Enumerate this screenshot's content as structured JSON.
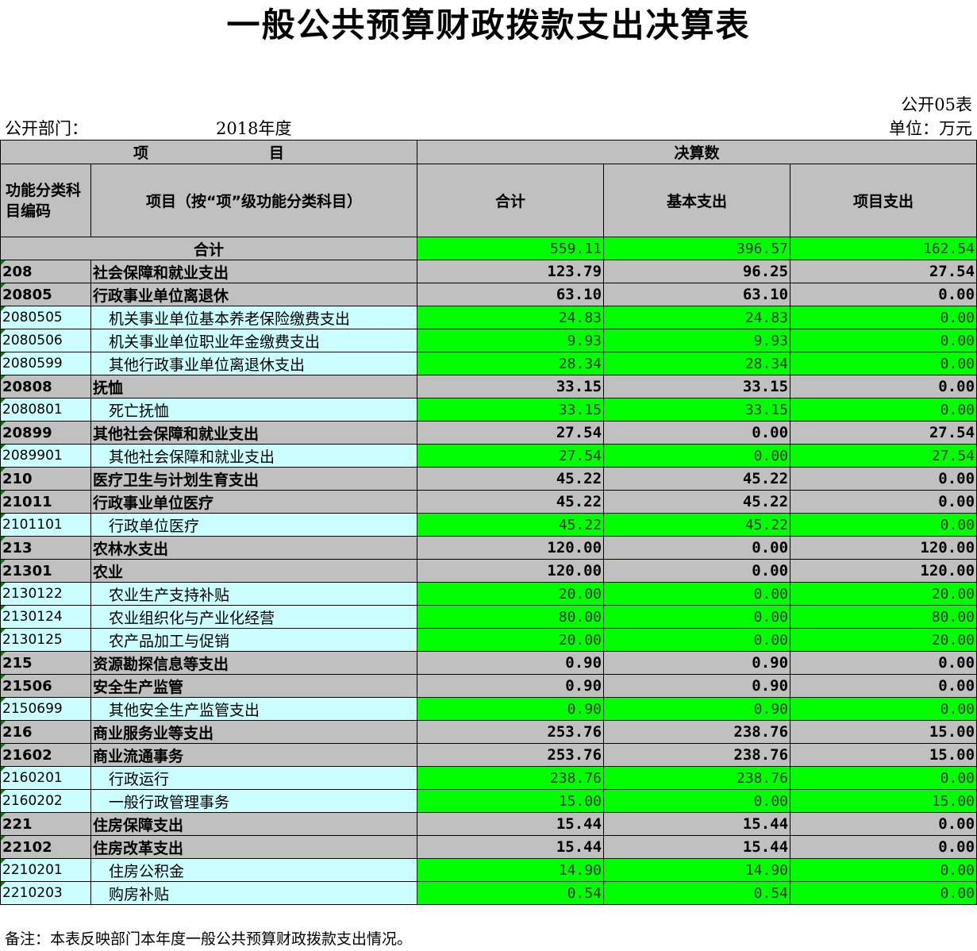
{
  "title": "一般公共预算财政拨款支出决算表",
  "form_code": "公开05表",
  "department_label": "公开部门：",
  "year": "2018年度",
  "unit": "单位：万元",
  "header": {
    "project": "项　　　　　　　　目",
    "final_accounts": "决算数",
    "code_col": "功能分类科目编码",
    "name_col": "项目（按“项”级功能分类科目）",
    "total_col": "合计",
    "basic_col": "基本支出",
    "project_col": "项目支出"
  },
  "total_row": {
    "label": "合计",
    "total": "559.11",
    "basic": "396.57",
    "project": "162.54"
  },
  "rows": [
    {
      "level": "group",
      "code": "208",
      "name": "社会保障和就业支出",
      "total": "123.79",
      "basic": "96.25",
      "project": "27.54"
    },
    {
      "level": "group",
      "code": "20805",
      "name": "行政事业单位离退休",
      "total": "63.10",
      "basic": "63.10",
      "project": "0.00"
    },
    {
      "level": "item",
      "code": "2080505",
      "name": "机关事业单位基本养老保险缴费支出",
      "total": "24.83",
      "basic": "24.83",
      "project": "0.00"
    },
    {
      "level": "item",
      "code": "2080506",
      "name": "机关事业单位职业年金缴费支出",
      "total": "9.93",
      "basic": "9.93",
      "project": "0.00"
    },
    {
      "level": "item",
      "code": "2080599",
      "name": "其他行政事业单位离退休支出",
      "total": "28.34",
      "basic": "28.34",
      "project": "0.00"
    },
    {
      "level": "group",
      "code": "20808",
      "name": "抚恤",
      "total": "33.15",
      "basic": "33.15",
      "project": "0.00"
    },
    {
      "level": "item",
      "code": "2080801",
      "name": "死亡抚恤",
      "total": "33.15",
      "basic": "33.15",
      "project": "0.00"
    },
    {
      "level": "group",
      "code": "20899",
      "name": "其他社会保障和就业支出",
      "total": "27.54",
      "basic": "0.00",
      "project": "27.54"
    },
    {
      "level": "item",
      "code": "2089901",
      "name": "其他社会保障和就业支出",
      "total": "27.54",
      "basic": "0.00",
      "project": "27.54"
    },
    {
      "level": "group",
      "code": "210",
      "name": "医疗卫生与计划生育支出",
      "total": "45.22",
      "basic": "45.22",
      "project": "0.00"
    },
    {
      "level": "group",
      "code": "21011",
      "name": "行政事业单位医疗",
      "total": "45.22",
      "basic": "45.22",
      "project": "0.00"
    },
    {
      "level": "item",
      "code": "2101101",
      "name": "行政单位医疗",
      "total": "45.22",
      "basic": "45.22",
      "project": "0.00"
    },
    {
      "level": "group",
      "code": "213",
      "name": "农林水支出",
      "total": "120.00",
      "basic": "0.00",
      "project": "120.00"
    },
    {
      "level": "group",
      "code": "21301",
      "name": "农业",
      "total": "120.00",
      "basic": "0.00",
      "project": "120.00"
    },
    {
      "level": "item",
      "code": "2130122",
      "name": "农业生产支持补贴",
      "total": "20.00",
      "basic": "0.00",
      "project": "20.00"
    },
    {
      "level": "item",
      "code": "2130124",
      "name": "农业组织化与产业化经营",
      "total": "80.00",
      "basic": "0.00",
      "project": "80.00"
    },
    {
      "level": "item",
      "code": "2130125",
      "name": "农产品加工与促销",
      "total": "20.00",
      "basic": "0.00",
      "project": "20.00"
    },
    {
      "level": "group",
      "code": "215",
      "name": "资源勘探信息等支出",
      "total": "0.90",
      "basic": "0.90",
      "project": "0.00"
    },
    {
      "level": "group",
      "code": "21506",
      "name": "安全生产监管",
      "total": "0.90",
      "basic": "0.90",
      "project": "0.00"
    },
    {
      "level": "item",
      "code": "2150699",
      "name": "其他安全生产监管支出",
      "total": "0.90",
      "basic": "0.90",
      "project": "0.00"
    },
    {
      "level": "group",
      "code": "216",
      "name": "商业服务业等支出",
      "total": "253.76",
      "basic": "238.76",
      "project": "15.00"
    },
    {
      "level": "group",
      "code": "21602",
      "name": "商业流通事务",
      "total": "253.76",
      "basic": "238.76",
      "project": "15.00"
    },
    {
      "level": "item",
      "code": "2160201",
      "name": "行政运行",
      "total": "238.76",
      "basic": "238.76",
      "project": "0.00"
    },
    {
      "level": "item",
      "code": "2160202",
      "name": "一般行政管理事务",
      "total": "15.00",
      "basic": "0.00",
      "project": "15.00"
    },
    {
      "level": "group",
      "code": "221",
      "name": "住房保障支出",
      "total": "15.44",
      "basic": "15.44",
      "project": "0.00"
    },
    {
      "level": "group",
      "code": "22102",
      "name": "住房改革支出",
      "total": "15.44",
      "basic": "15.44",
      "project": "0.00"
    },
    {
      "level": "item",
      "code": "2210201",
      "name": "住房公积金",
      "total": "14.90",
      "basic": "14.90",
      "project": "0.00"
    },
    {
      "level": "item",
      "code": "2210203",
      "name": "购房补贴",
      "total": "0.54",
      "basic": "0.54",
      "project": "0.00"
    }
  ],
  "note": "备注：本表反映部门本年度一般公共预算财政拨款支出情况。"
}
